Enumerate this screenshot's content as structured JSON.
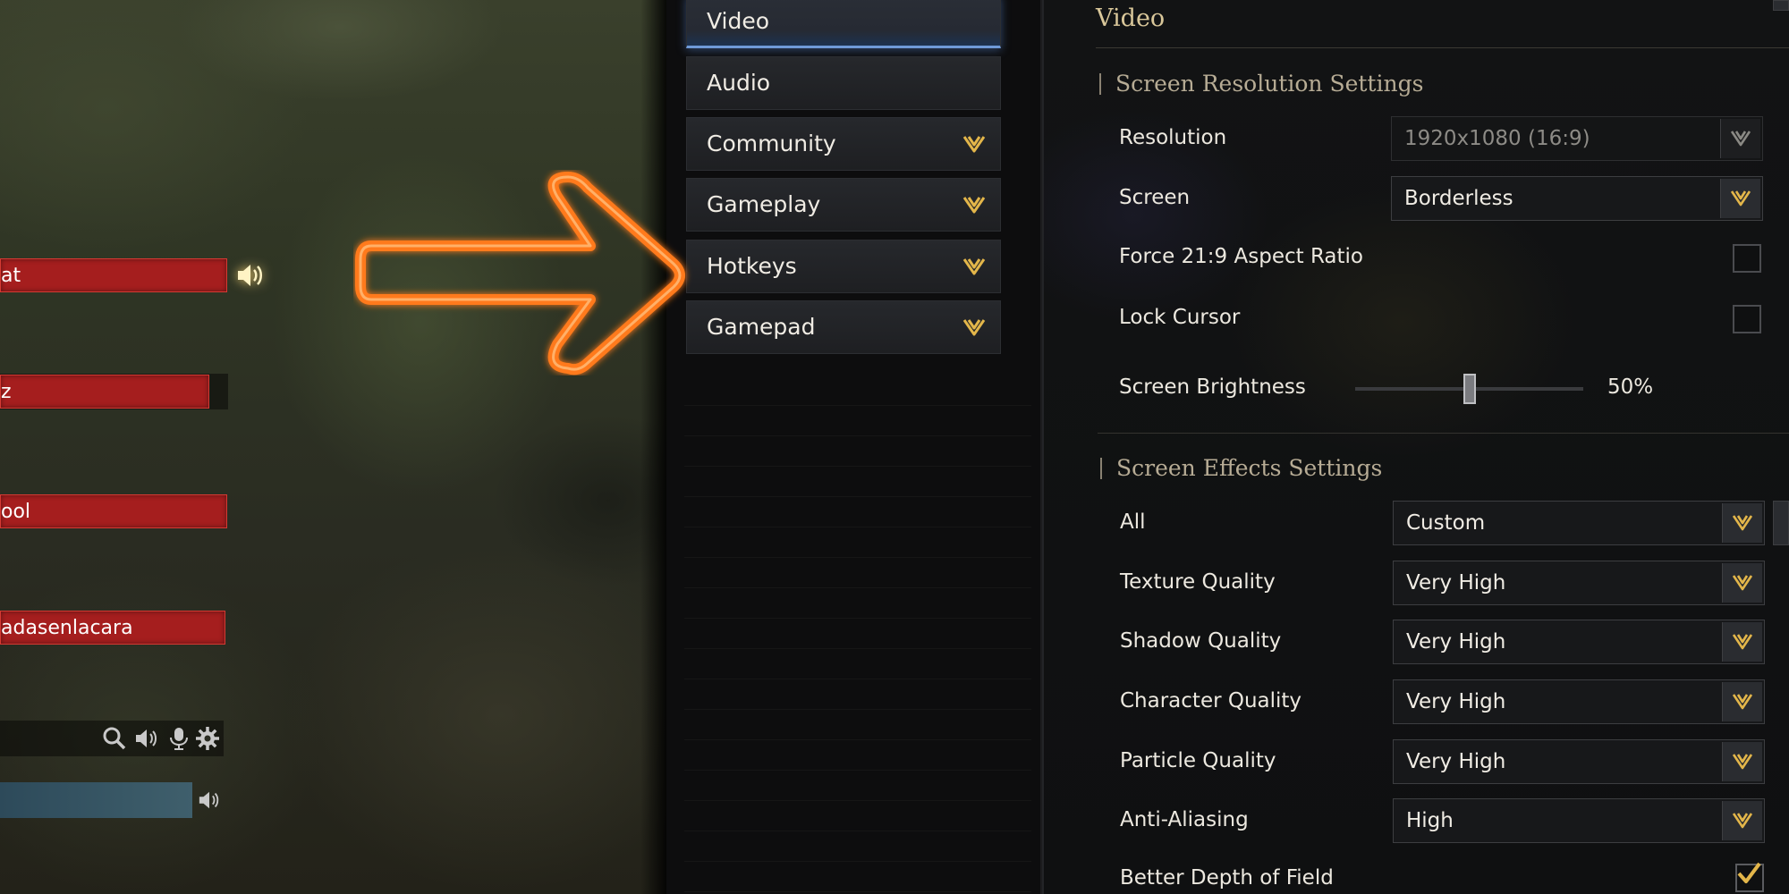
{
  "voice_chat": {
    "users": [
      {
        "name": "at"
      },
      {
        "name": "z"
      },
      {
        "name": "ool"
      },
      {
        "name": "adasenlacara"
      }
    ],
    "icons": [
      "speaker-icon",
      "search-icon",
      "speaker-icon",
      "microphone-icon",
      "gear-icon",
      "speaker-icon"
    ]
  },
  "categories": [
    {
      "label": "Video",
      "active": true,
      "expandable": false
    },
    {
      "label": "Audio",
      "active": false,
      "expandable": false
    },
    {
      "label": "Community",
      "active": false,
      "expandable": true
    },
    {
      "label": "Gameplay",
      "active": false,
      "expandable": true
    },
    {
      "label": "Hotkeys",
      "active": false,
      "expandable": true
    },
    {
      "label": "Gamepad",
      "active": false,
      "expandable": true
    }
  ],
  "settings": {
    "title": "Video",
    "resolution_section": {
      "title": "Screen Resolution Settings",
      "resolution": {
        "label": "Resolution",
        "value": "1920x1080 (16:9)"
      },
      "screen": {
        "label": "Screen",
        "value": "Borderless"
      },
      "force_aspect": {
        "label": "Force 21:9 Aspect Ratio",
        "checked": false
      },
      "lock_cursor": {
        "label": "Lock Cursor",
        "checked": false
      },
      "brightness": {
        "label": "Screen Brightness",
        "value": "50%",
        "level": 0.5
      }
    },
    "effects_section": {
      "title": "Screen Effects Settings",
      "all": {
        "label": "All",
        "value": "Custom"
      },
      "texture": {
        "label": "Texture Quality",
        "value": "Very High"
      },
      "shadow": {
        "label": "Shadow Quality",
        "value": "Very High"
      },
      "character": {
        "label": "Character Quality",
        "value": "Very High"
      },
      "particle": {
        "label": "Particle Quality",
        "value": "Very High"
      },
      "anti_aliasing": {
        "label": "Anti-Aliasing",
        "value": "High"
      },
      "depth_of_field": {
        "label": "Better Depth of Field",
        "checked": true
      }
    }
  },
  "colors": {
    "accent_gold": "#e3b64a",
    "voice_bar_red": "#a51e1e",
    "active_tab_blue": "#6f9ad8",
    "arrow_orange": "#ff7a1a"
  }
}
